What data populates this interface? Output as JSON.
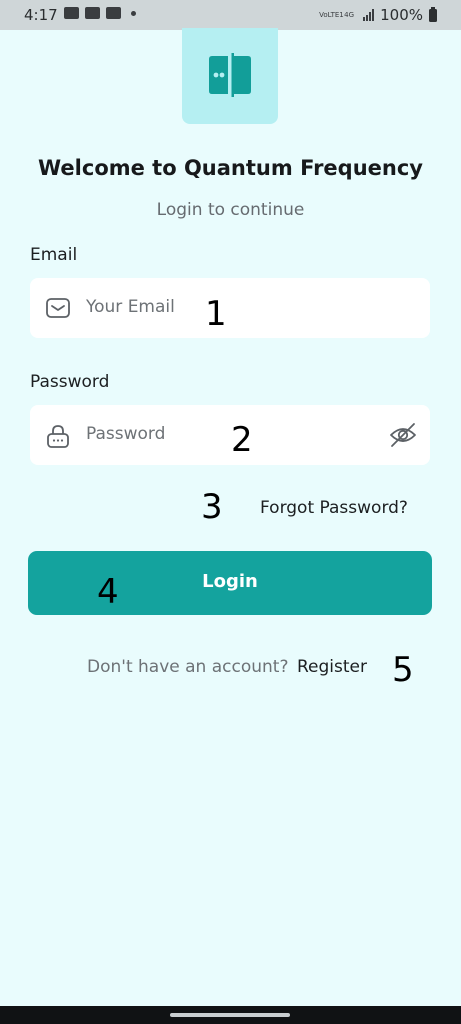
{
  "status_bar": {
    "time": "4:17",
    "network_tag_1": "VoLTE1",
    "network_tag_2": "4G",
    "battery": "100%"
  },
  "app": {
    "title": "Welcome to Quantum Frequency",
    "subtitle": "Login to continue",
    "logo_icon": "door-split-icon",
    "accent_color": "#14a39e",
    "logo_bg_color": "#b5eff2",
    "page_bg_color": "#e9fcfd"
  },
  "email": {
    "label": "Email",
    "placeholder": "Your Email",
    "icon": "mail-icon"
  },
  "password": {
    "label": "Password",
    "placeholder": "Password",
    "icon": "lock-icon",
    "toggle_icon": "eye-off-icon"
  },
  "forgot_password": "Forgot Password?",
  "login_button": "Login",
  "register": {
    "prompt": "Don't have an account?",
    "link": "Register"
  },
  "annotations": [
    "1",
    "2",
    "3",
    "4",
    "5"
  ]
}
